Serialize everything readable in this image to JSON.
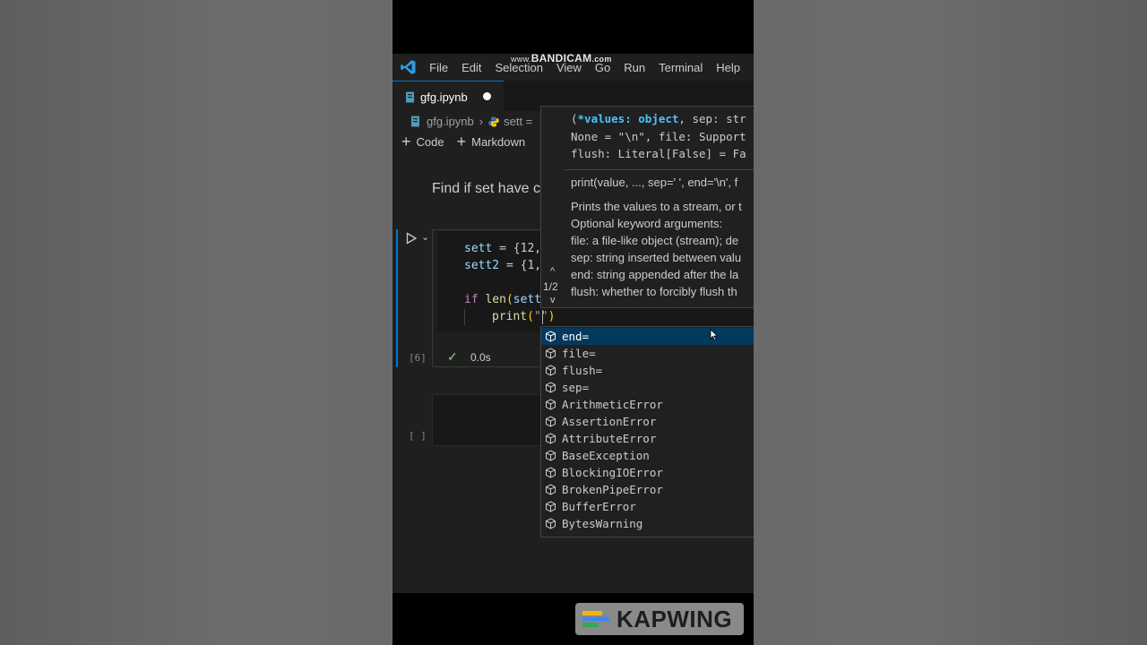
{
  "watermark": {
    "prefix": "www.",
    "brand": "BANDICAM",
    "suffix": ".com"
  },
  "menu": [
    "File",
    "Edit",
    "Selection",
    "View",
    "Go",
    "Run",
    "Terminal",
    "Help"
  ],
  "tab": {
    "label": "gfg.ipynb"
  },
  "breadcrumb": {
    "file": "gfg.ipynb",
    "symbol": "sett ="
  },
  "toolbar": {
    "code_label": "Code",
    "markdown_label": "Markdown"
  },
  "markdown_cell_text": "Find if set have c",
  "code_cell": {
    "line1": {
      "var": "sett",
      "rest": " = {12,"
    },
    "line2": {
      "var": "sett2",
      "rest": " = {1,"
    },
    "line3": {
      "kw": "if",
      "fn": "len",
      "arg": "sett"
    },
    "line4": {
      "fn": "print",
      "str": "\"\""
    },
    "execution_count": "[6]",
    "status_time": "0.0s"
  },
  "empty_cell": {
    "execution_count": "[ ]"
  },
  "hover": {
    "sig_line1_param": "*values: object",
    "sig_line1_rest": ", sep: str",
    "sig_line2": "None = \"\\n\", file: Support",
    "sig_line3": "flush: Literal[False] = Fa",
    "short_sig": "print(value, ..., sep=' ', end='\\n', f",
    "doc_lines": [
      "Prints the values to a stream, or t",
      "Optional keyword arguments:",
      "file: a file-like object (stream); de",
      "sep: string inserted between valu",
      "end: string appended after the la",
      "flush: whether to forcibly flush th"
    ],
    "overload": "1/2"
  },
  "suggestions": {
    "selected_index": 0,
    "items": [
      "end=",
      "file=",
      "flush=",
      "sep=",
      "ArithmeticError",
      "AssertionError",
      "AttributeError",
      "BaseException",
      "BlockingIOError",
      "BrokenPipeError",
      "BufferError",
      "BytesWarning"
    ]
  },
  "kapwing": {
    "text": "KAPWING"
  },
  "colors": {
    "accent": "#0078d4",
    "editor_bg": "#1f1f1f",
    "selection": "#04395e",
    "keyword": "#c586c0",
    "function": "#dcdcaa"
  }
}
